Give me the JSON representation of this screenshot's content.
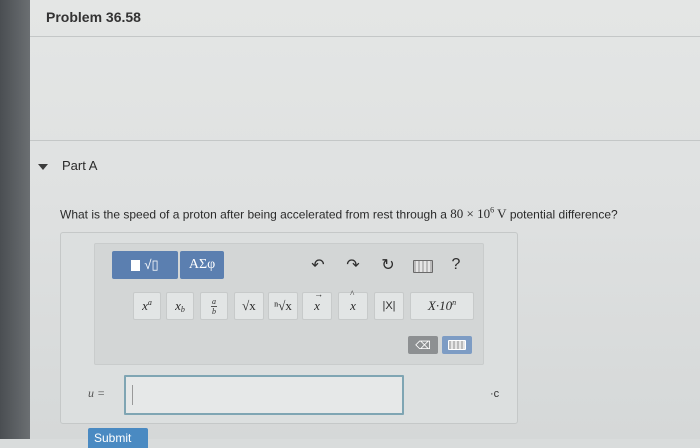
{
  "problem": {
    "title": "Problem 36.58"
  },
  "part": {
    "label": "Part A"
  },
  "question": {
    "before": "What is the speed of a proton after being accelerated from rest through a ",
    "value": "80 × 10",
    "exponent": "6",
    "unit": "V",
    "after": " potential difference?"
  },
  "toolbar": {
    "templates_tab": "√▯",
    "greek_tab": "ΑΣφ",
    "help_label": "?",
    "buttons": {
      "power": "x",
      "power_sup": "a",
      "subscript": "x",
      "subscript_sub": "b",
      "fraction_num": "a",
      "fraction_den": "b",
      "sqrt": "√x",
      "nthroot": "ⁿ√x",
      "vector": "x",
      "unit_vector": "x",
      "abs": "|X|",
      "sci": "X·10",
      "sci_sup": "n"
    },
    "delete_label": "⌫"
  },
  "answer": {
    "variable": "u =",
    "value": "",
    "units": "·c"
  },
  "submit": {
    "label": "Submit"
  },
  "colors": {
    "accent": "#5b7fb0",
    "input_border": "#7fa5b3",
    "submit": "#4a8ac2"
  }
}
